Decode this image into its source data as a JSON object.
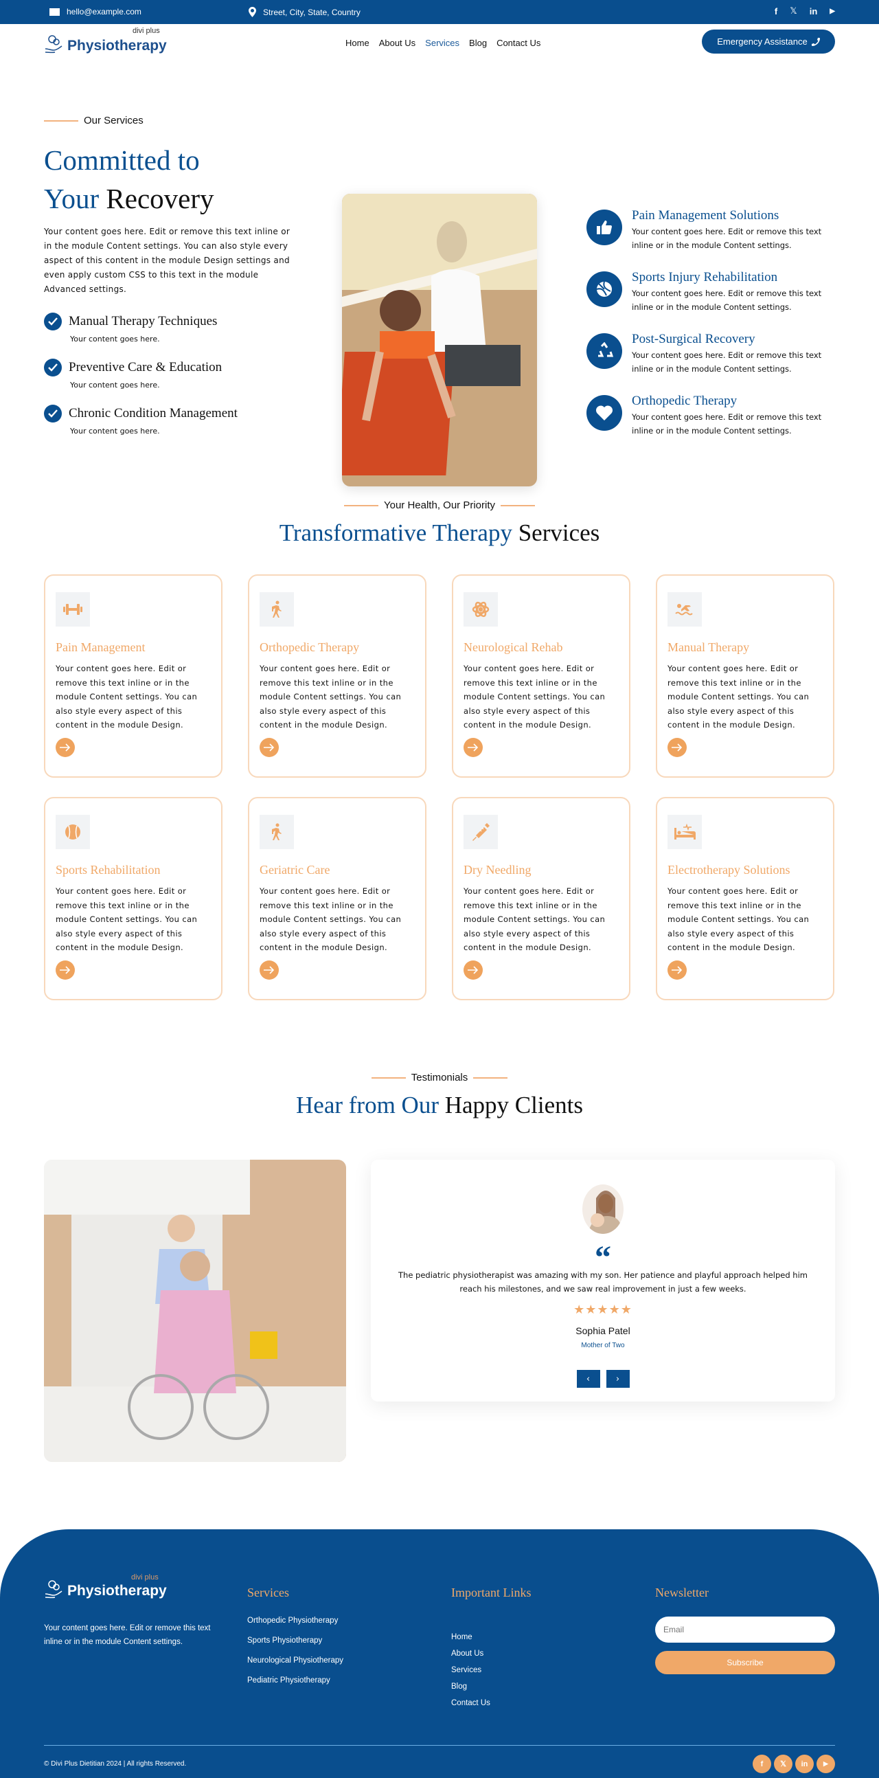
{
  "topbar": {
    "email": "hello@example.com",
    "address": "Street, City, State, Country",
    "socials": [
      "facebook-icon",
      "x-icon",
      "linkedin-icon",
      "youtube-icon"
    ],
    "social_glyphs": [
      "f",
      "𝕏",
      "in",
      "▶"
    ]
  },
  "header": {
    "logo_small": "divi plus",
    "logo_big": "Physiotherapy",
    "nav": [
      "Home",
      "About Us",
      "Services",
      "Blog",
      "Contact Us"
    ],
    "active_nav": "Services",
    "cta_label": "Emergency Assistance"
  },
  "hero": {
    "eyebrow": "Our Services",
    "title_line1": "Committed to",
    "title_line2_blue": "Your",
    "title_line2_dark": "Recovery",
    "lead": "Your content goes here. Edit or remove this text inline or in the module Content settings. You can also style every aspect of this content in the module Design settings and even apply custom CSS to this text in the module Advanced settings.",
    "checks": [
      {
        "title": "Manual Therapy Techniques",
        "sub": "Your content goes here."
      },
      {
        "title": "Preventive Care & Education",
        "sub": "Your content goes here."
      },
      {
        "title": "Chronic Condition Management",
        "sub": "Your content goes here."
      }
    ],
    "features": [
      {
        "icon": "thumbs-up-icon",
        "title": "Pain Management Solutions",
        "text": "Your content goes here. Edit or remove this text inline or in the module Content settings."
      },
      {
        "icon": "volleyball-icon",
        "title": "Sports Injury Rehabilitation",
        "text": "Your content goes here. Edit or remove this text inline or in the module Content settings."
      },
      {
        "icon": "recycle-icon",
        "title": "Post-Surgical Recovery",
        "text": "Your content goes here. Edit or remove this text inline or in the module Content settings."
      },
      {
        "icon": "heart-icon",
        "title": "Orthopedic Therapy",
        "text": "Your content goes here. Edit or remove this text inline or in the module Content settings."
      }
    ]
  },
  "services": {
    "eyebrow": "Your Health, Our Priority",
    "title_blue": "Transformative Therapy",
    "title_dark": "Services",
    "cards": [
      {
        "icon": "dumbbell-icon",
        "title": "Pain Management",
        "text": "Your content goes here. Edit or remove this text inline or in the module Content settings. You can also style every aspect of this content in the module Design."
      },
      {
        "icon": "walking-icon",
        "title": "Orthopedic Therapy",
        "text": "Your content goes here. Edit or remove this text inline or in the module Content settings. You can also style every aspect of this content in the module Design."
      },
      {
        "icon": "atom-icon",
        "title": "Neurological Rehab",
        "text": "Your content goes here. Edit or remove this text inline or in the module Content settings. You can also style every aspect of this content in the module Design."
      },
      {
        "icon": "swimmer-icon",
        "title": "Manual Therapy",
        "text": "Your content goes here. Edit or remove this text inline or in the module Content settings. You can also style every aspect of this content in the module Design."
      },
      {
        "icon": "baseball-icon",
        "title": "Sports Rehabilitation",
        "text": "Your content goes here. Edit or remove this text inline or in the module Content settings. You can also style every aspect of this content in the module Design."
      },
      {
        "icon": "walking-icon",
        "title": "Geriatric Care",
        "text": "Your content goes here. Edit or remove this text inline or in the module Content settings. You can also style every aspect of this content in the module Design."
      },
      {
        "icon": "syringe-icon",
        "title": "Dry Needling",
        "text": "Your content goes here. Edit or remove this text inline or in the module Content settings. You can also style every aspect of this content in the module Design."
      },
      {
        "icon": "hospital-bed-icon",
        "title": "Electrotherapy Solutions",
        "text": "Your content goes here. Edit or remove this text inline or in the module Content settings. You can also style every aspect of this content in the module Design."
      }
    ]
  },
  "testimonials": {
    "eyebrow": "Testimonials",
    "title_blue": "Hear from Our",
    "title_dark": "Happy Clients",
    "quote_mark": "“",
    "text": "The pediatric physiotherapist was amazing with my son. Her patience and playful approach helped him reach his milestones, and we saw real improvement in just a few weeks.",
    "rating": 5,
    "stars": "★★★★★",
    "name": "Sophia Patel",
    "role": "Mother of Two",
    "prev": "‹",
    "next": "›"
  },
  "footer": {
    "logo_small": "divi plus",
    "logo_big": "Physiotherapy",
    "description": "Your content goes here. Edit or remove this text inline or in the module Content settings.",
    "services_title": "Services",
    "services": [
      "Orthopedic Physiotherapy",
      "Sports Physiotherapy",
      "Neurological Physiotherapy",
      "Pediatric Physiotherapy"
    ],
    "links_title": "Important Links",
    "links": [
      "Home",
      "About Us",
      "Services",
      "Blog",
      "Contact Us"
    ],
    "newsletter_title": "Newsletter",
    "email_placeholder": "Email",
    "subscribe_label": "Subscribe",
    "copyright": "© Divi Plus Dietitian 2024 | All rights Reserved."
  },
  "colors": {
    "brand_blue": "#094e8e",
    "accent_orange": "#f0a868"
  }
}
